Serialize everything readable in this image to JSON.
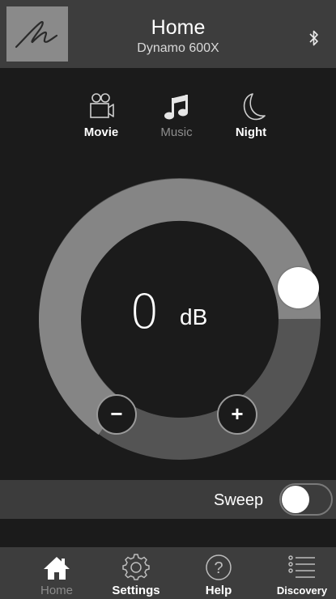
{
  "header": {
    "title": "Home",
    "subtitle": "Dynamo 600X",
    "logo_icon": "signature-logo-icon",
    "bluetooth_icon": "bluetooth-icon"
  },
  "modes": [
    {
      "label": "Movie",
      "icon": "movie-camera-icon",
      "active": true
    },
    {
      "label": "Music",
      "icon": "music-note-icon",
      "active": false
    },
    {
      "label": "Night",
      "icon": "crescent-moon-icon",
      "active": true
    }
  ],
  "volume": {
    "value": "0",
    "unit": "dB",
    "minus_label": "−",
    "plus_label": "+"
  },
  "sweep": {
    "label": "Sweep",
    "enabled": false
  },
  "tabs": [
    {
      "label": "Home",
      "icon": "home-icon",
      "current": true
    },
    {
      "label": "Settings",
      "icon": "gear-icon",
      "current": false
    },
    {
      "label": "Help",
      "icon": "help-icon",
      "current": false
    },
    {
      "label": "Discovery",
      "icon": "list-icon",
      "current": false
    }
  ],
  "colors": {
    "background": "#1b1b1b",
    "header": "#3d3d3d",
    "ring": "#858585",
    "ring_dark": "#545454",
    "inactive": "#8e8e8e"
  }
}
